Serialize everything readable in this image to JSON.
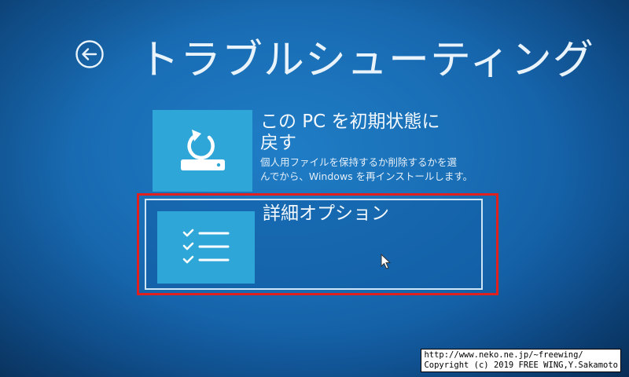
{
  "header": {
    "title": "トラブルシューティング",
    "back_icon": "back-arrow-icon"
  },
  "options": [
    {
      "title_line1": "この PC を初期状態に",
      "title_line2": "戻す",
      "desc_line1": "個人用ファイルを保持するか削除するかを選",
      "desc_line2": "んでから、Windows を再インストールします。",
      "icon": "reset-pc-icon"
    },
    {
      "title_line1": "詳細オプション",
      "icon": "checklist-icon"
    }
  ],
  "watermark": {
    "line1": "http://www.neko.ne.jp/~freewing/",
    "line2": "Copyright (c) 2019 FREE WING,Y.Sakamoto"
  },
  "colors": {
    "background": "#1a6fb6",
    "tile": "#2ea7d8",
    "highlight": "#e0201e",
    "selection_border": "#cfe6f7"
  }
}
